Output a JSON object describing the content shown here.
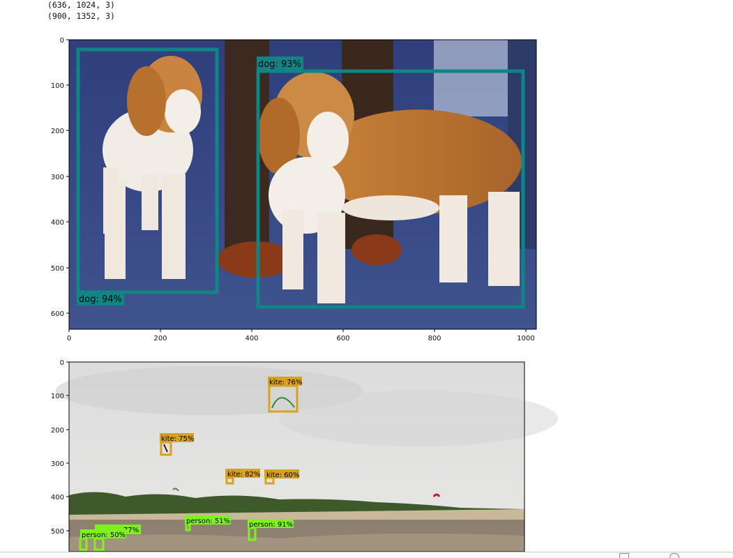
{
  "output": {
    "lines": [
      "(636, 1024, 3)",
      "(900, 1352, 3)"
    ]
  },
  "figure1": {
    "xticks": [
      "0",
      "200",
      "400",
      "600",
      "800",
      "1000"
    ],
    "yticks": [
      "0",
      "100",
      "200",
      "300",
      "400",
      "500",
      "600"
    ],
    "detections": [
      {
        "label": "dog: 94%"
      },
      {
        "label": "dog: 93%"
      }
    ]
  },
  "figure2": {
    "yticks": [
      "0",
      "100",
      "200",
      "300",
      "400",
      "500"
    ],
    "detections": [
      {
        "label": "kite: 76%"
      },
      {
        "label": "kite: 75%"
      },
      {
        "label": "kite: 82%"
      },
      {
        "label": "kite: 60%"
      },
      {
        "label": "person: 51%"
      },
      {
        "label": "person: 91%"
      },
      {
        "label": "person: 50%"
      },
      {
        "label": "77%"
      }
    ]
  },
  "colors": {
    "dog_box": "#0f8585",
    "kite_box": "#d8a21e",
    "person_box": "#7ef21a"
  }
}
